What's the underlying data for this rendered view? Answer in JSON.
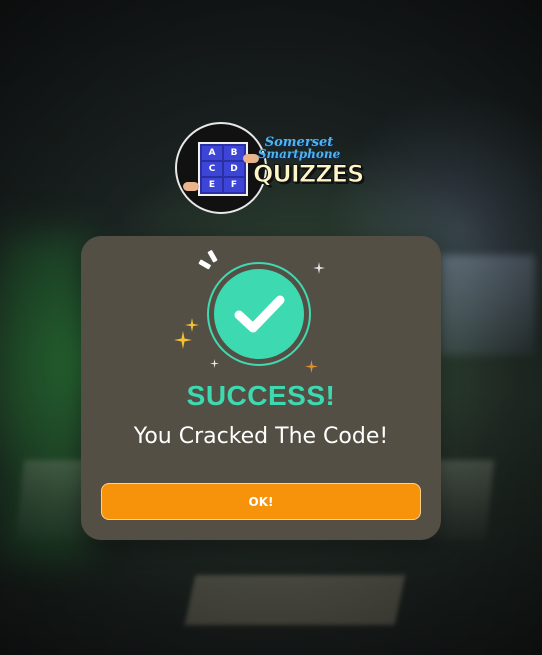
{
  "logo": {
    "grid_letters": [
      "A",
      "B",
      "C",
      "D",
      "E",
      "F"
    ],
    "line1": "Somerset",
    "line2": "Smartphone",
    "line3": "QUIZZES"
  },
  "modal": {
    "title": "SUCCESS!",
    "message": "You Cracked The Code!",
    "ok_label": "OK!"
  },
  "icons": {
    "status": "check-circle-icon",
    "decor": [
      "burst-icon",
      "sparkle-icon"
    ]
  },
  "colors": {
    "modal_bg": "#544f45",
    "accent_green": "#3dd9b1",
    "button_orange": "#f7930a",
    "sparkle_gold": "#f2c230"
  }
}
